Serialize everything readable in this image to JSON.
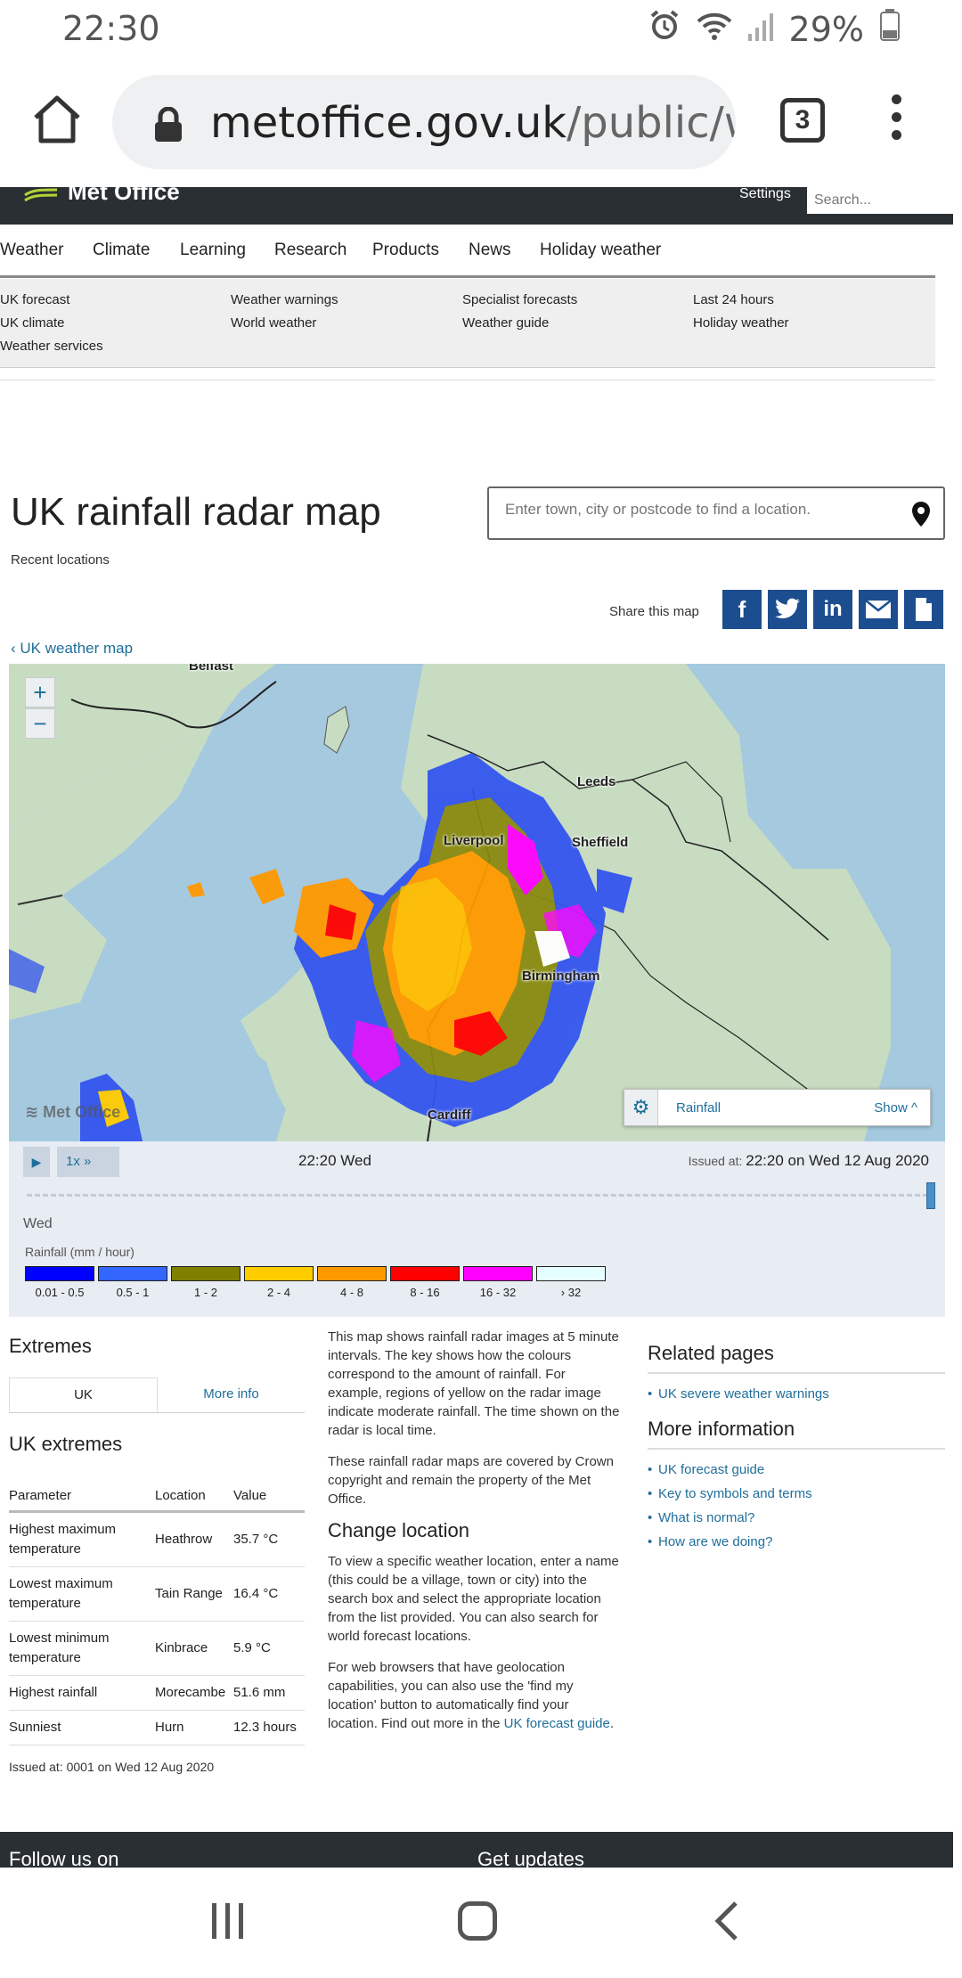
{
  "status_bar": {
    "time": "22:30",
    "battery": "29%"
  },
  "browser": {
    "url_host": "metoffice.gov.uk",
    "url_path": "/public/wea",
    "tab_count": "3"
  },
  "site_header": {
    "logo_text": "Met Office",
    "settings": "Settings",
    "search_placeholder": "Search..."
  },
  "nav": {
    "items": [
      "Weather",
      "Climate",
      "Learning",
      "Research",
      "Products",
      "News",
      "Holiday weather"
    ]
  },
  "subnav": {
    "items": [
      "UK forecast",
      "Weather warnings",
      "Specialist forecasts",
      "Last 24 hours",
      "UK climate",
      "World weather",
      "Weather guide",
      "Holiday weather",
      "Weather services"
    ]
  },
  "page": {
    "title": "UK rainfall radar map",
    "recent_locations": "Recent locations",
    "location_placeholder": "Enter town, city or postcode to find a location.",
    "share_label": "Share this map",
    "back_link": "UK weather map"
  },
  "map": {
    "cities": [
      "Belfast",
      "Leeds",
      "Liverpool",
      "Sheffield",
      "Birmingham",
      "Cardiff"
    ],
    "layer_label": "Rainfall",
    "show_label": "Show",
    "logo_text": "Met Office"
  },
  "player": {
    "speed": "1x",
    "current_time": "22:20 Wed",
    "issued_prefix": "Issued at:",
    "issued_value": "22:20 on Wed 12 Aug 2020",
    "day": "Wed",
    "legend_title": "Rainfall (mm / hour)",
    "legend": [
      {
        "label": "0.01 - 0.5",
        "color": "#0000ff"
      },
      {
        "label": "0.5 - 1",
        "color": "#3366ff"
      },
      {
        "label": "1 - 2",
        "color": "#808000"
      },
      {
        "label": "2 - 4",
        "color": "#ffcc00"
      },
      {
        "label": "4 - 8",
        "color": "#ff9900"
      },
      {
        "label": "8 - 16",
        "color": "#ff0000"
      },
      {
        "label": "16 - 32",
        "color": "#ff00ff"
      },
      {
        "label": "› 32",
        "color": "#e5feff"
      }
    ]
  },
  "extremes": {
    "heading": "Extremes",
    "tab_uk": "UK",
    "tab_more": "More info",
    "subheading": "UK extremes",
    "columns": [
      "Parameter",
      "Location",
      "Value"
    ],
    "rows": [
      [
        "Highest maximum temperature",
        "Heathrow",
        "35.7 °C"
      ],
      [
        "Lowest maximum temperature",
        "Tain Range",
        "16.4 °C"
      ],
      [
        "Lowest minimum temperature",
        "Kinbrace",
        "5.9 °C"
      ],
      [
        "Highest rainfall",
        "Morecambe",
        "51.6 mm"
      ],
      [
        "Sunniest",
        "Hurn",
        "12.3 hours"
      ]
    ],
    "issued": "Issued at: 0001 on Wed 12 Aug 2020"
  },
  "info": {
    "para1": "This map shows rainfall radar images at 5 minute intervals. The key shows how the colours correspond to the amount of rainfall. For example, regions of yellow on the radar image indicate moderate rainfall. The time shown on the radar is local time.",
    "para2": "These rainfall radar maps are covered by Crown copyright and remain the property of the Met Office.",
    "change_heading": "Change location",
    "para3": "To view a specific weather location, enter a name (this could be a village, town or city) into the search box and select the appropriate location from the list provided. You can also search for world forecast locations.",
    "para4_start": "For web browsers that have geolocation capabilities, you can also use the 'find my location' button to automatically find your location. Find out more in the ",
    "para4_link": "UK forecast guide",
    "para4_end": "."
  },
  "related": {
    "heading": "Related pages",
    "links": [
      "UK severe weather warnings"
    ],
    "more_heading": "More information",
    "more_links": [
      "UK forecast guide",
      "Key to symbols and terms",
      "What is normal?",
      "How are we doing?"
    ]
  },
  "footer": {
    "left": "Follow us on",
    "right": "Get updates"
  }
}
